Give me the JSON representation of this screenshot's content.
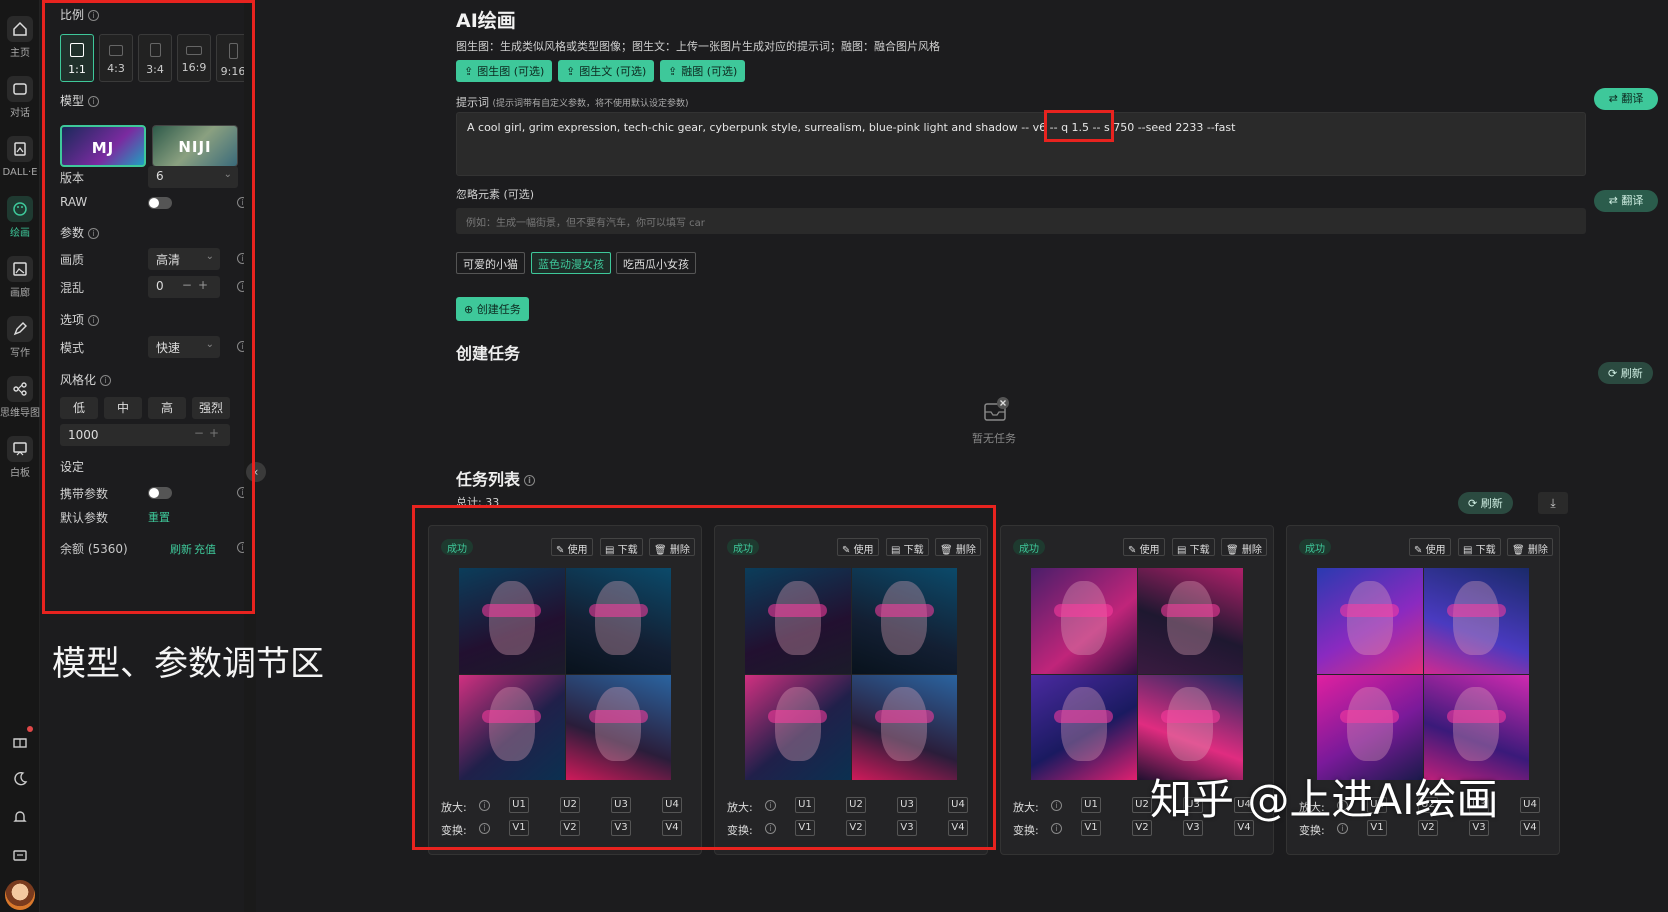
{
  "rail": {
    "items": [
      {
        "label": "主页",
        "icon": "home-icon"
      },
      {
        "label": "对话",
        "icon": "chat-icon"
      },
      {
        "label": "DALL·E",
        "icon": "image-gen-icon"
      },
      {
        "label": "绘画",
        "icon": "palette-icon"
      },
      {
        "label": "画廊",
        "icon": "gallery-icon"
      },
      {
        "label": "写作",
        "icon": "pen-icon"
      },
      {
        "label": "思维导图",
        "icon": "mindmap-icon"
      },
      {
        "label": "白板",
        "icon": "whiteboard-icon"
      }
    ],
    "active": "绘画"
  },
  "panel": {
    "ratio_label": "比例",
    "ratios": [
      "1:1",
      "4:3",
      "3:4",
      "16:9",
      "9:16"
    ],
    "ratio_selected": "1:1",
    "model_label": "模型",
    "models": [
      "MJ",
      "NIJI"
    ],
    "model_selected": "MJ",
    "version_label": "版本",
    "version_value": "6",
    "raw_label": "RAW",
    "params_label": "参数",
    "quality_label": "画质",
    "quality_value": "高清",
    "chaos_label": "混乱",
    "chaos_value": "0",
    "options_label": "选项",
    "mode_label": "模式",
    "mode_value": "快速",
    "stylize_label": "风格化",
    "stylize_options": [
      "低",
      "中",
      "高",
      "强烈"
    ],
    "stylize_value": "1000",
    "settings_label": "设定",
    "carry_params_label": "携带参数",
    "default_params_label": "默认参数",
    "reset_label": "重置",
    "balance_label": "余额 (5360)",
    "refresh_label": "刷新",
    "recharge_label": "充值"
  },
  "panel_caption": "模型、参数调节区",
  "main": {
    "title": "AI绘画",
    "subtitle": "图生图：生成类似风格或类型图像；图生文：上传一张图片生成对应的提示词；融图：融合图片风格",
    "upload_buttons": [
      "图生图 (可选)",
      "图生文 (可选)",
      "融图 (可选)"
    ],
    "prompt_label": "提示词",
    "prompt_hint": "(提示词带有自定义参数，将不使用默认设定参数)",
    "translate_label": "翻译",
    "prompt_text": "A cool girl, grim expression, tech-chic gear, cyberpunk style, surrealism, blue-pink light and shadow -- v6 -- q 1.5 -- s 750 --seed 2233 --fast",
    "negative_label": "忽略元素 (可选)",
    "negative_placeholder": "例如：生成一幅街景，但不要有汽车，你可以填写 car",
    "presets": [
      "可爱的小猫",
      "蓝色动漫女孩",
      "吃西瓜小女孩"
    ],
    "preset_selected": "蓝色动漫女孩",
    "create_button": "创建任务",
    "create_section_title": "创建任务",
    "refresh_label": "刷新",
    "empty_text": "暂无任务",
    "tasks_title": "任务列表",
    "total_label": "总计: 33"
  },
  "card_template": {
    "status": "成功",
    "use_label": "使用",
    "download_label": "下载",
    "delete_label": "删除",
    "upscale_label": "放大:",
    "variation_label": "变换:",
    "upscale_buttons": [
      "U1",
      "U2",
      "U3",
      "U4"
    ],
    "variation_buttons": [
      "V1",
      "V2",
      "V3",
      "V4"
    ]
  },
  "cards": [
    {
      "status": "成功"
    },
    {
      "status": "成功"
    },
    {
      "status": "成功"
    },
    {
      "status": "成功"
    }
  ],
  "watermark": "知乎 @上进AI绘画",
  "colors": {
    "accent": "#3ec89a",
    "highlight": "#e8231f",
    "background": "#1c1c1e"
  }
}
